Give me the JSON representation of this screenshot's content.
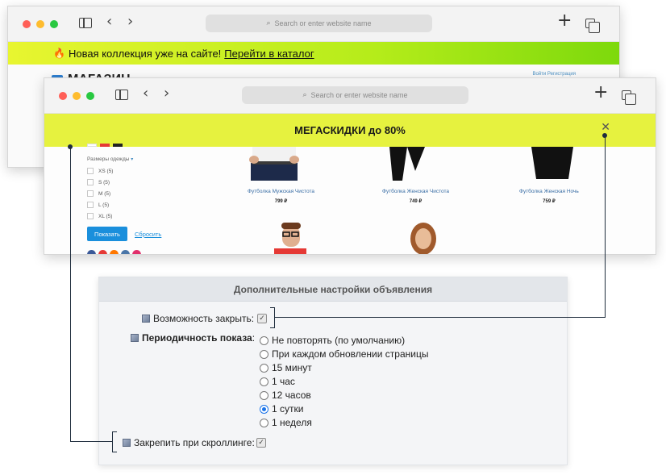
{
  "browser": {
    "address_placeholder": "Search or enter website name"
  },
  "back_window": {
    "banner_text": "Новая коллекция уже на сайте!",
    "banner_link": "Перейти в каталог",
    "logo_text": "МАГАЗИН",
    "auth_links": "Войти   Регистрация"
  },
  "front_window": {
    "banner_text": "МЕГАСКИДКИ до 80%",
    "close_icon": "close-icon",
    "filter_title": "Размеры одежды",
    "sizes": [
      "XS (5)",
      "S (5)",
      "M (5)",
      "L (5)",
      "XL (5)"
    ],
    "show_button": "Показать",
    "reset_link": "Сбросить",
    "products": [
      {
        "name": "Футболка Мужская Чистота",
        "price": "799 ₽"
      },
      {
        "name": "Футболка Женская Чистота",
        "price": "749 ₽"
      },
      {
        "name": "Футболка Женская Ночь",
        "price": "759 ₽"
      }
    ]
  },
  "settings": {
    "title": "Дополнительные настройки объявления",
    "closable_label": "Возможность закрыть:",
    "closable_checked": true,
    "frequency_label": "Периодичность показа",
    "frequency_colon": ":",
    "frequency_options": [
      "Не повторять (по умолчанию)",
      "При каждом обновлении страницы",
      "15 минут",
      "1 час",
      "12 часов",
      "1 сутки",
      "1 неделя"
    ],
    "frequency_selected": "1 сутки",
    "sticky_label": "Закрепить при скроллинге:",
    "sticky_checked": true
  }
}
